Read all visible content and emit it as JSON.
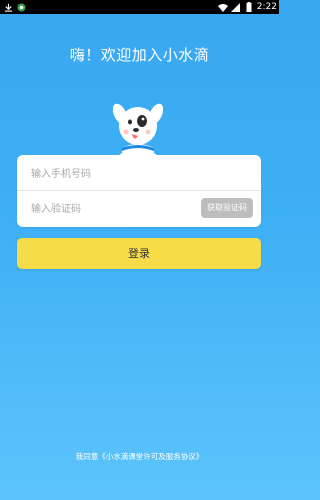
{
  "status_bar": {
    "time": "2:22",
    "left_icons": [
      "download-icon",
      "app-notification-icon"
    ],
    "right_icons": [
      "wifi-icon",
      "signal-icon",
      "battery-icon"
    ]
  },
  "header": {
    "title": "嗨！欢迎加入小水滴"
  },
  "form": {
    "phone_placeholder": "输入手机号码",
    "code_placeholder": "输入验证码",
    "get_code_label": "获取验证码"
  },
  "login": {
    "label": "登录"
  },
  "footer": {
    "agreement": "我同意《小水滴课堂许可及服务协议》"
  },
  "colors": {
    "background_top": "#39a7f0",
    "background_bottom": "#5cc4fb",
    "login_button": "#f7dc4a",
    "code_button": "#bdbdbd"
  }
}
